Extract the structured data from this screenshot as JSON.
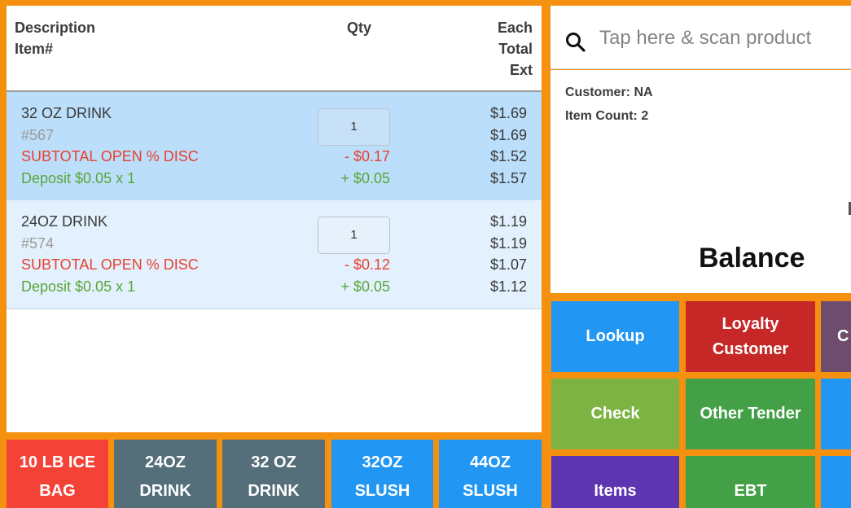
{
  "cart": {
    "headers": {
      "description": "Description",
      "item_num": "Item#",
      "qty": "Qty",
      "each": "Each",
      "total": "Total",
      "ext": "Ext"
    },
    "rows": [
      {
        "name": "32 OZ DRINK",
        "number": "#567",
        "discount_label": "SUBTOTAL OPEN % DISC",
        "deposit_label": "Deposit $0.05 x 1",
        "qty": "1",
        "discount_amount": "- $0.17",
        "deposit_amount": "+ $0.05",
        "each": "$1.69",
        "total": "$1.69",
        "after_discount": "$1.52",
        "ext": "$1.57",
        "selected": true
      },
      {
        "name": "24OZ DRINK",
        "number": "#574",
        "discount_label": "SUBTOTAL OPEN % DISC",
        "deposit_label": "Deposit $0.05 x 1",
        "qty": "1",
        "discount_amount": "- $0.12",
        "deposit_amount": "+ $0.05",
        "each": "$1.19",
        "total": "$1.19",
        "after_discount": "$1.07",
        "ext": "$1.12",
        "selected": false
      }
    ]
  },
  "quick_items": [
    {
      "line1": "10 LB ICE",
      "line2": "BAG",
      "color": "#f44336"
    },
    {
      "line1": "24OZ",
      "line2": "DRINK",
      "color": "#546e7a"
    },
    {
      "line1": "32 OZ",
      "line2": "DRINK",
      "color": "#546e7a"
    },
    {
      "line1": "32OZ",
      "line2": "SLUSH",
      "color": "#2196f3"
    },
    {
      "line1": "44OZ",
      "line2": "SLUSH",
      "color": "#2196f3"
    }
  ],
  "search": {
    "icon": "search-icon",
    "placeholder": "Tap here & scan product"
  },
  "info": {
    "customer": "Customer: NA",
    "item_count": "Item Count: 2",
    "balance_label": "Balance"
  },
  "actions": [
    {
      "label": "Lookup",
      "color": "#2196f3"
    },
    {
      "label_line1": "Loyalty",
      "label_line2": "Customer",
      "color": "#c62828"
    },
    {
      "label": "C",
      "color": "#6d4c6e"
    },
    {
      "label": "Check",
      "color": "#7cb342"
    },
    {
      "label": "Other Tender",
      "color": "#43a047"
    },
    {
      "label": "",
      "color": "#2196f3"
    },
    {
      "label": "Items",
      "color": "#5e35b1"
    },
    {
      "label": "EBT",
      "color": "#43a047"
    },
    {
      "label": "",
      "color": "#2196f3"
    }
  ],
  "colors": {
    "frame": "#f5910f",
    "selected_row": "#bbdefa",
    "row": "#e2f1fd",
    "discount": "#e8412e",
    "deposit": "#5aa637"
  }
}
